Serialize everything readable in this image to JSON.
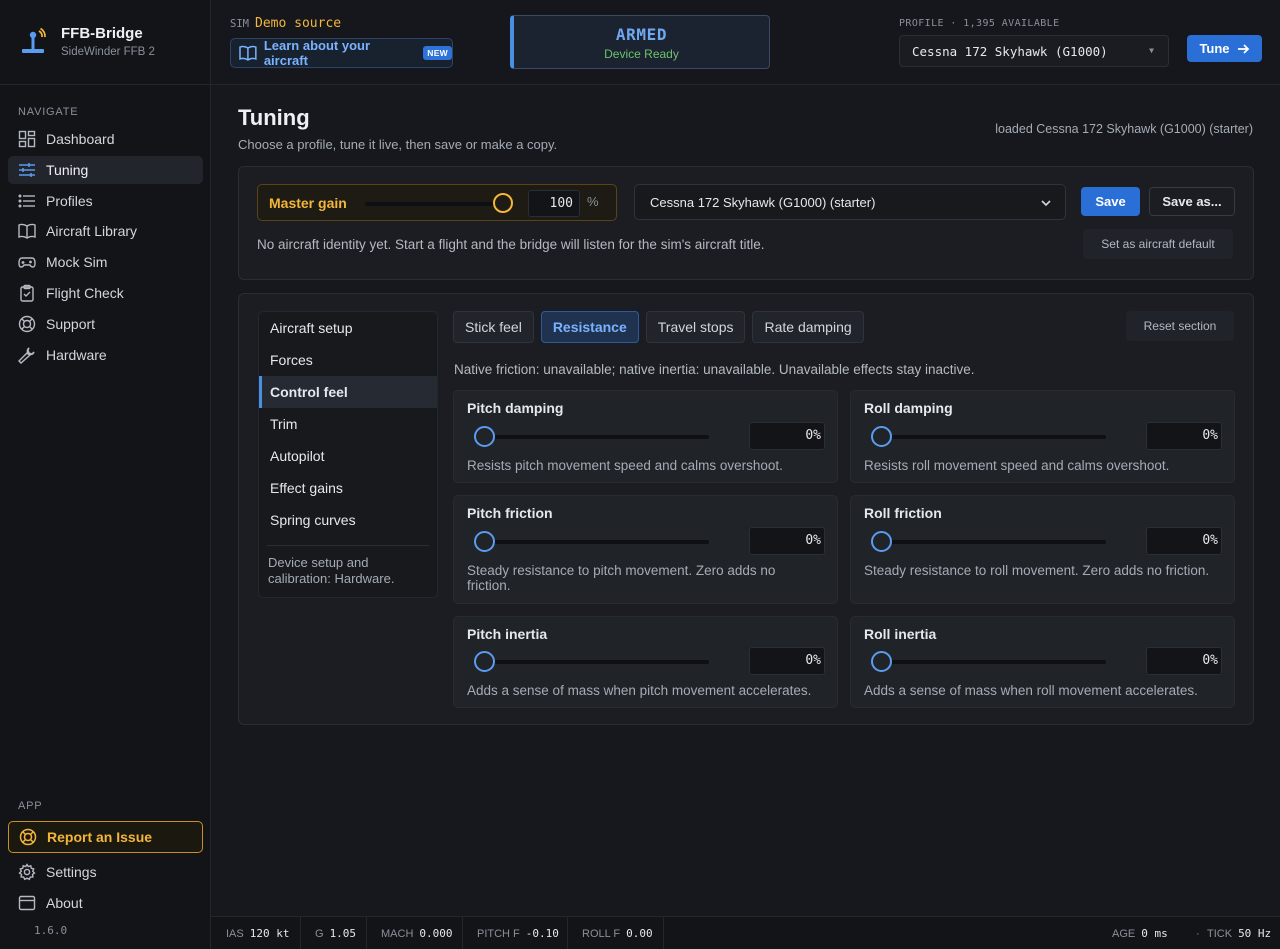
{
  "brand": {
    "name": "FFB-Bridge",
    "device": "SideWinder FFB 2"
  },
  "nav": {
    "heading": "NAVIGATE",
    "items": [
      {
        "label": "Dashboard",
        "icon": "dashboard-icon"
      },
      {
        "label": "Tuning",
        "icon": "sliders-icon",
        "active": true
      },
      {
        "label": "Profiles",
        "icon": "list-icon"
      },
      {
        "label": "Aircraft Library",
        "icon": "book-icon"
      },
      {
        "label": "Mock Sim",
        "icon": "gamepad-icon"
      },
      {
        "label": "Flight Check",
        "icon": "clipboard-icon"
      },
      {
        "label": "Support",
        "icon": "lifebuoy-icon"
      },
      {
        "label": "Hardware",
        "icon": "wrench-icon"
      }
    ],
    "app_heading": "APP",
    "report_label": "Report an Issue",
    "settings_label": "Settings",
    "about_label": "About",
    "version": "1.6.0"
  },
  "topbar": {
    "sim_label": "SIM",
    "sim_value": "Demo source",
    "learn_label": "Learn about your aircraft",
    "new_badge": "NEW",
    "armed_title": "ARMED",
    "armed_sub": "Device Ready",
    "profile_meta": "PROFILE · 1,395 AVAILABLE",
    "profile_value": "Cessna 172 Skyhawk (G1000)",
    "tune_label": "Tune"
  },
  "page": {
    "title": "Tuning",
    "subtitle": "Choose a profile, tune it live, then save or make a copy.",
    "loaded": "loaded Cessna 172 Skyhawk (G1000) (starter)"
  },
  "master": {
    "label": "Master gain",
    "value": "100",
    "unit": "%",
    "level": 1.0,
    "profile": "Cessna 172 Skyhawk (G1000) (starter)",
    "save_label": "Save",
    "save_as_label": "Save as...",
    "identity_msg": "No aircraft identity yet. Start a flight and the bridge will listen for the sim's aircraft title.",
    "default_label": "Set as aircraft default"
  },
  "sections": {
    "items": [
      "Aircraft setup",
      "Forces",
      "Control feel",
      "Trim",
      "Autopilot",
      "Effect gains",
      "Spring curves"
    ],
    "active": "Control feel",
    "note": "Device setup and calibration: Hardware."
  },
  "tabs": {
    "items": [
      "Stick feel",
      "Resistance",
      "Travel stops",
      "Rate damping"
    ],
    "active": "Resistance",
    "reset_label": "Reset section"
  },
  "native_msg": "Native friction: unavailable; native inertia: unavailable. Unavailable effects stay inactive.",
  "cards": [
    {
      "title": "Pitch damping",
      "value": "0%",
      "desc": "Resists pitch movement speed and calms overshoot."
    },
    {
      "title": "Roll damping",
      "value": "0%",
      "desc": "Resists roll movement speed and calms overshoot."
    },
    {
      "title": "Pitch friction",
      "value": "0%",
      "desc": "Steady resistance to pitch movement. Zero adds no friction."
    },
    {
      "title": "Roll friction",
      "value": "0%",
      "desc": "Steady resistance to roll movement. Zero adds no friction."
    },
    {
      "title": "Pitch inertia",
      "value": "0%",
      "desc": "Adds a sense of mass when pitch movement accelerates."
    },
    {
      "title": "Roll inertia",
      "value": "0%",
      "desc": "Adds a sense of mass when roll movement accelerates."
    }
  ],
  "status": {
    "ias_label": "IAS",
    "ias": "120 kt",
    "g_label": "G",
    "g": "1.05",
    "mach_label": "MACH",
    "mach": "0.000",
    "pitch_label": "PITCH F",
    "pitch": "-0.10",
    "roll_label": "ROLL F",
    "roll": "0.00",
    "age_label": "AGE",
    "age": "0 ms",
    "tick_label": "TICK",
    "tick": "50 Hz"
  },
  "colors": {
    "accent": "#2a6fd6",
    "warning": "#f2b63a",
    "ok": "#6dc36d",
    "bg": "#16181d"
  }
}
